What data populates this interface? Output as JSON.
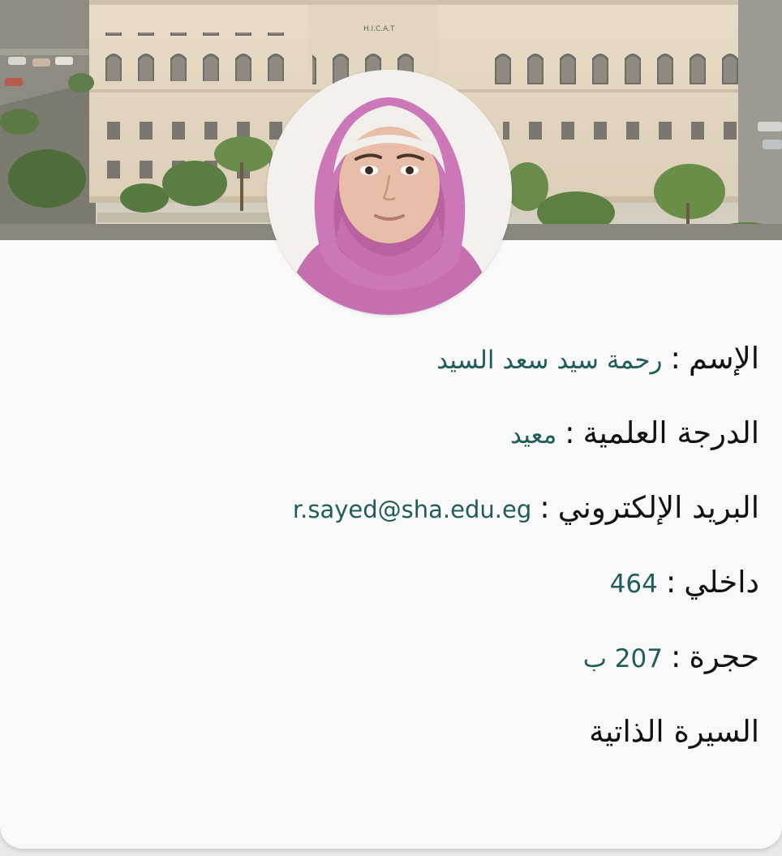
{
  "banner": {
    "building_sign": "H.I.C.A.T"
  },
  "profile": {
    "rows": [
      {
        "label": "الإسم",
        "separator": ":",
        "value": "رحمة سيد سعد السيد"
      },
      {
        "label": "الدرجة العلمية",
        "separator": ":",
        "value": "معيد"
      },
      {
        "label": "البريد الإلكتروني",
        "separator": ":",
        "value": "r.sayed@sha.edu.eg"
      },
      {
        "label": "داخلي",
        "separator": ":",
        "value": "464"
      },
      {
        "label": "حجرة",
        "separator": ":",
        "value": "207 ب"
      }
    ],
    "cv_link": "السيرة الذاتية"
  },
  "colors": {
    "value_text": "#1f5c5a",
    "label_text": "#111111",
    "card_bg": "#f9f9f9",
    "hijab": "#c873b4"
  }
}
